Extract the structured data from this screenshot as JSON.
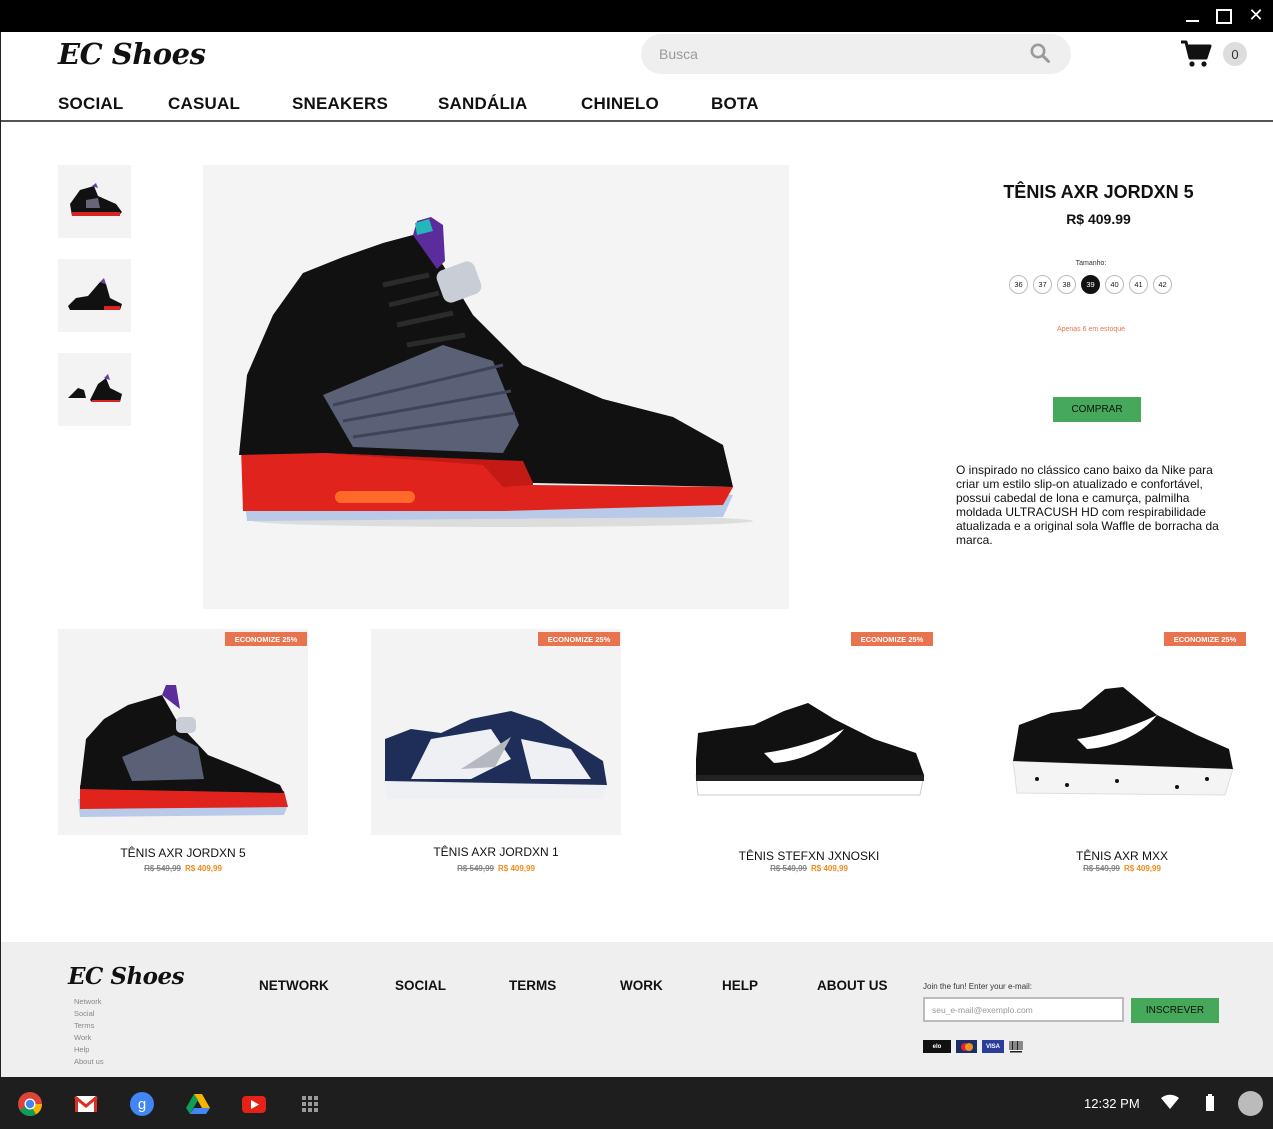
{
  "window": {
    "controls": [
      "minimize-icon",
      "maximize-icon",
      "close-icon"
    ]
  },
  "header": {
    "logo": "EC Shoes",
    "search": {
      "placeholder": "Busca",
      "value": ""
    },
    "cart": {
      "icon": "cart-icon",
      "count": "0"
    }
  },
  "nav": {
    "items": [
      "SOCIAL",
      "CASUAL",
      "SNEAKERS",
      "SANDÁLIA",
      "CHINELO",
      "BOTA"
    ]
  },
  "product": {
    "title": "TÊNIS AXR JORDXN 5",
    "price": "R$ 409.99",
    "size_label": "Tamanho:",
    "sizes": [
      "36",
      "37",
      "38",
      "39",
      "40",
      "41",
      "42"
    ],
    "selected_size": "39",
    "stock": "Apenas 6 em estoque",
    "buy_label": "COMPRAR",
    "description": "O inspirado no clássico cano baixo da Nike para criar um estilo slip-on atualizado e confortável, possui cabedal de lona e camurça, palmilha moldada ULTRACUSH HD com respirabilidade atualizada e a original sola Waffle de borracha da marca."
  },
  "cards": [
    {
      "badge": "ECONOMIZE 25%",
      "name": "TÊNIS AXR JORDXN 5",
      "old_price": "R$ 549,99",
      "new_price": "R$ 409,99"
    },
    {
      "badge": "ECONOMIZE 25%",
      "name": "TÊNIS AXR JORDXN 1",
      "old_price": "R$ 549,99",
      "new_price": "R$ 409,99"
    },
    {
      "badge": "ECONOMIZE 25%",
      "name": "TÊNIS STEFXN JXNOSKI",
      "old_price": "R$ 549,99",
      "new_price": "R$ 409,99"
    },
    {
      "badge": "ECONOMIZE 25%",
      "name": "TÊNIS AXR MXX",
      "old_price": "R$ 549,99",
      "new_price": "R$ 409,99"
    }
  ],
  "footer": {
    "logo": "EC Shoes",
    "links": [
      "Network",
      "Social",
      "Terms",
      "Work",
      "Help",
      "About us"
    ],
    "nav": [
      "NETWORK",
      "SOCIAL",
      "TERMS",
      "WORK",
      "HELP",
      "ABOUT US"
    ],
    "join_text": "Join the fun! Enter your e-mail:",
    "email_placeholder": "seu_e-mail@exemplo.com",
    "subscribe_label": "INSCREVER",
    "payment": [
      "elo",
      "mastercard",
      "VISA",
      "boleto"
    ]
  },
  "shelf": {
    "apps": [
      "chrome-icon",
      "gmail-icon",
      "google-icon",
      "drive-icon",
      "youtube-icon",
      "launcher-icon"
    ],
    "time": "12:32 PM"
  },
  "colors": {
    "accent_green": "#45a85a",
    "badge_orange": "#e8734f",
    "sale_price": "#f28a1c"
  }
}
